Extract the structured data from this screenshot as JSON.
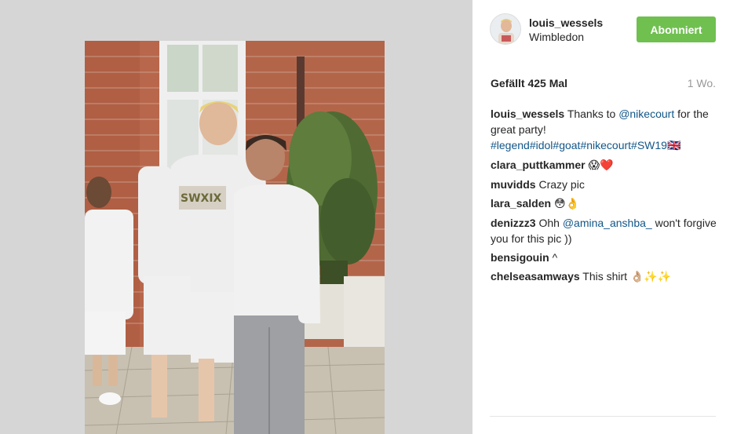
{
  "post": {
    "username": "louis_wessels",
    "location": "Wimbledon",
    "follow_label": "Abonniert",
    "likes": "Gefällt 425 Mal",
    "time": "1 Wo."
  },
  "caption": {
    "user": "louis_wessels",
    "text_1": "Thanks to ",
    "mention": "@nikecourt",
    "text_2": " for the great party!",
    "hashtags": "#legend#idol#goat#nikecourt#SW19",
    "flag": "🇬🇧"
  },
  "comments": [
    {
      "user": "clara_puttkammer",
      "text": "",
      "emoji": "😱❤️"
    },
    {
      "user": "muvidds",
      "text": "Crazy pic",
      "emoji": ""
    },
    {
      "user": "lara_salden",
      "text": "",
      "emoji": "😳👌"
    },
    {
      "user": "denizzz3",
      "text_1": "Ohh ",
      "mention": "@amina_anshba_",
      "text_2": " won't forgive you for this pic ))"
    },
    {
      "user": "bensigouin",
      "text": "^",
      "emoji": ""
    },
    {
      "user": "chelseasamways",
      "text": "This shirt",
      "emoji": "👌🏼✨✨"
    }
  ],
  "colors": {
    "follow_button": "#70c050",
    "link": "#125688",
    "media_background": "#d6d6d6"
  },
  "icons": {
    "avatar": "user-avatar"
  }
}
